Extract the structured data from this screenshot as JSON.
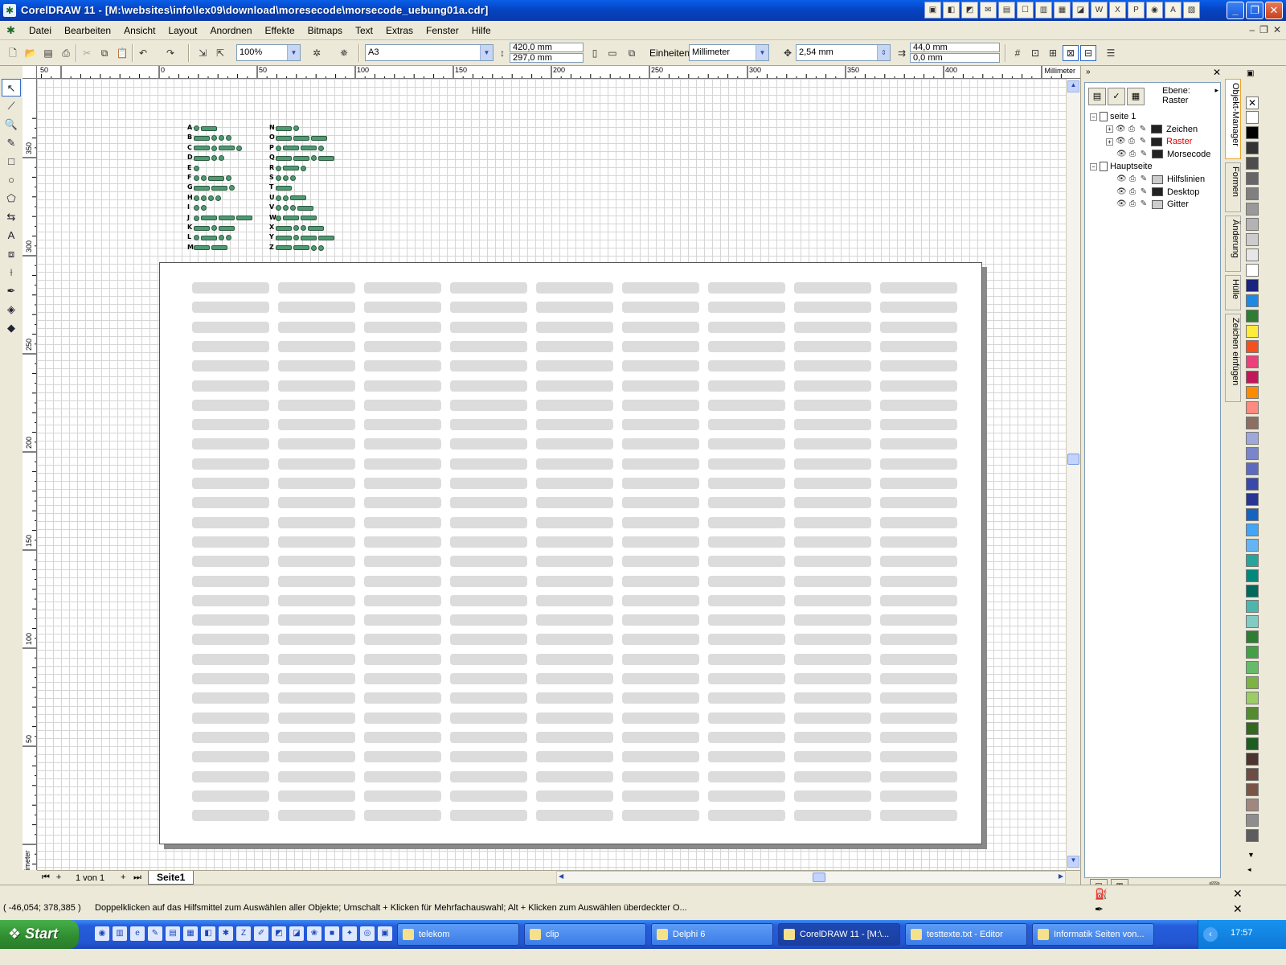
{
  "window": {
    "title": "CorelDRAW 11 - [M:\\websites\\info\\lex09\\download\\moresecode\\morsecode_uebung01a.cdr]",
    "app_icon": "coreldraw-balloon-icon"
  },
  "menu": [
    "Datei",
    "Bearbeiten",
    "Ansicht",
    "Layout",
    "Anordnen",
    "Effekte",
    "Bitmaps",
    "Text",
    "Extras",
    "Fenster",
    "Hilfe"
  ],
  "propbar": {
    "zoom": "100%",
    "paper_size": "A3",
    "width": "420,0 mm",
    "height": "297,0 mm",
    "units_label": "Einheiten:",
    "units": "Millimeter",
    "nudge": "2,54 mm",
    "dup_x": "44,0 mm",
    "dup_y": "0,0 mm"
  },
  "ruler": {
    "h_labels": [
      "50",
      "0",
      "50",
      "100",
      "150",
      "200",
      "250",
      "300",
      "350",
      "400"
    ],
    "h_unit": "Millimeter",
    "v_labels": [
      "350",
      "300",
      "250",
      "200",
      "150",
      "100",
      "50"
    ],
    "v_unit": "Millimeter"
  },
  "morse_code": {
    "left": [
      {
        "letter": "A",
        "code": ".-"
      },
      {
        "letter": "B",
        "code": "-..."
      },
      {
        "letter": "C",
        "code": "-.-."
      },
      {
        "letter": "D",
        "code": "-.."
      },
      {
        "letter": "E",
        "code": "."
      },
      {
        "letter": "F",
        "code": "..-."
      },
      {
        "letter": "G",
        "code": "--."
      },
      {
        "letter": "H",
        "code": "...."
      },
      {
        "letter": "I",
        "code": ".."
      },
      {
        "letter": "J",
        "code": ".---"
      },
      {
        "letter": "K",
        "code": "-.-"
      },
      {
        "letter": "L",
        "code": ".-.."
      },
      {
        "letter": "M",
        "code": "--"
      }
    ],
    "right": [
      {
        "letter": "N",
        "code": "-."
      },
      {
        "letter": "O",
        "code": "---"
      },
      {
        "letter": "P",
        "code": ".--."
      },
      {
        "letter": "Q",
        "code": "--.-"
      },
      {
        "letter": "R",
        "code": ".-."
      },
      {
        "letter": "S",
        "code": "..."
      },
      {
        "letter": "T",
        "code": "-"
      },
      {
        "letter": "U",
        "code": "..-"
      },
      {
        "letter": "V",
        "code": "...-"
      },
      {
        "letter": "W",
        "code": ".--"
      },
      {
        "letter": "X",
        "code": "-..-"
      },
      {
        "letter": "Y",
        "code": "-.--"
      },
      {
        "letter": "Z",
        "code": "--.."
      }
    ]
  },
  "grid": {
    "columns": 9,
    "rows": 28
  },
  "bottombar": {
    "page_count": "1 von 1",
    "page_tab": "Seite1"
  },
  "docker": {
    "layer_label": "Ebene:",
    "layer_name": "Raster",
    "tree": [
      {
        "label": "seite 1",
        "level": 0,
        "type": "page"
      },
      {
        "label": "Zeichen",
        "level": 1,
        "type": "layer",
        "color": "#222222"
      },
      {
        "label": "Raster",
        "level": 1,
        "type": "layer",
        "color": "#222222",
        "active": true
      },
      {
        "label": "Morsecode",
        "level": 1,
        "type": "layer",
        "color": "#222222"
      },
      {
        "label": "Hauptseite",
        "level": 0,
        "type": "page"
      },
      {
        "label": "Hilfslinien",
        "level": 1,
        "type": "layer",
        "color": "#cccccc"
      },
      {
        "label": "Desktop",
        "level": 1,
        "type": "layer",
        "color": "#222222"
      },
      {
        "label": "Gitter",
        "level": 1,
        "type": "layer",
        "color": "#cccccc"
      }
    ],
    "active_color": "#e00000"
  },
  "vtabs": [
    "Objekt-Manager",
    "Formen",
    "Änderung",
    "Hülle",
    "Zeichen einfügen"
  ],
  "palette": [
    "#ffffff",
    "#000000",
    "#333333",
    "#4d4d4d",
    "#666666",
    "#808080",
    "#999999",
    "#b3b3b3",
    "#cccccc",
    "#e6e6e6",
    "#ffffff",
    "#1a237e",
    "#1e88e5",
    "#2e7d32",
    "#ffeb3b",
    "#f4511e",
    "#ec407a",
    "#c2185b",
    "#fb8c00",
    "#ff8a80",
    "#8d6e63",
    "#9fa8da",
    "#7986cb",
    "#5c6bc0",
    "#3949ab",
    "#283593",
    "#1565c0",
    "#42a5f5",
    "#64b5f6",
    "#26a69a",
    "#00897b",
    "#00695c",
    "#4db6ac",
    "#80cbc4",
    "#2e7d32",
    "#43a047",
    "#66bb6a",
    "#7cb342",
    "#9ccc65",
    "#558b2f",
    "#33691e",
    "#1b5e20",
    "#4e342e",
    "#6d4c41",
    "#795548",
    "#a1887f",
    "#8e8e8e",
    "#5d5d5d"
  ],
  "status": {
    "coords": "( -46,054; 378,385 )",
    "hint": "Doppelklicken auf das Hilfsmittel zum Auswählen aller Objekte; Umschalt + Klicken für Mehrfachauswahl; Alt + Klicken zum Auswählen überdeckter O..."
  },
  "taskbar": {
    "start": "Start",
    "tasks": [
      {
        "label": "telekom"
      },
      {
        "label": "clip"
      },
      {
        "label": "Delphi 6"
      },
      {
        "label": "CorelDRAW 11 - [M:\\...",
        "active": true
      },
      {
        "label": "testtexte.txt - Editor"
      },
      {
        "label": "Informatik Seiten von..."
      }
    ],
    "clock": "17:57"
  }
}
